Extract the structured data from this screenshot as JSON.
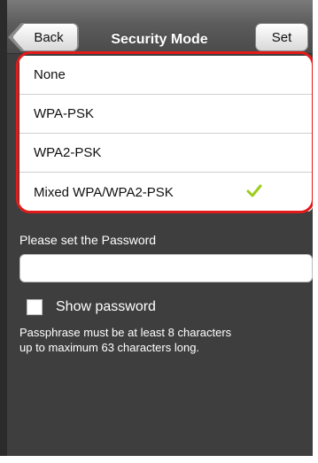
{
  "nav": {
    "back_label": "Back",
    "title": "Security Mode",
    "set_label": "Set"
  },
  "security_options": [
    {
      "label": "None",
      "selected": false
    },
    {
      "label": "WPA-PSK",
      "selected": false
    },
    {
      "label": "WPA2-PSK",
      "selected": false
    },
    {
      "label": "Mixed WPA/WPA2-PSK",
      "selected": true
    }
  ],
  "password": {
    "label": "Please set the Password",
    "value": "",
    "placeholder": ""
  },
  "show_password": {
    "label": "Show password",
    "checked": false
  },
  "hint": "Passphrase must be at least 8 characters up to maximum 63 characters long.",
  "colors": {
    "background": "#3e3e3e",
    "highlight": "#e21a1a",
    "checkmark": "#9ccc1c"
  }
}
